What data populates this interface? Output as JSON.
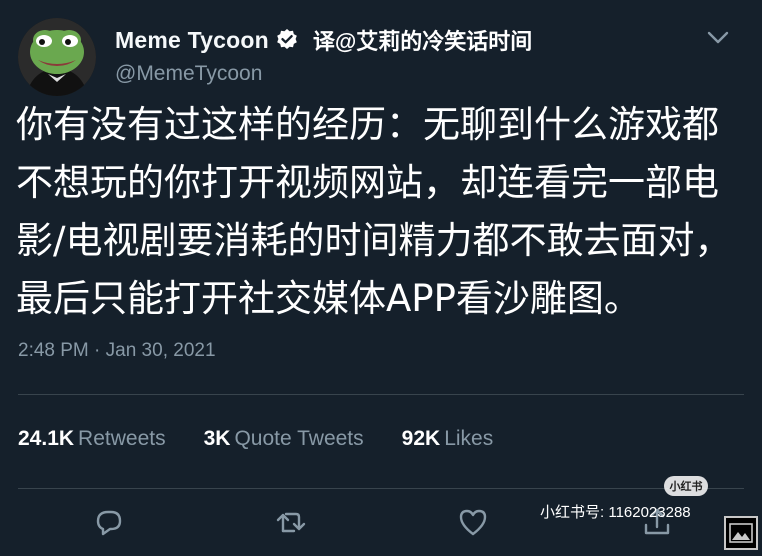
{
  "user": {
    "display_name": "Meme Tycoon",
    "handle": "@MemeTycoon",
    "verified": true
  },
  "overlay_credit": "译@艾莉的冷笑话时间",
  "tweet": {
    "lines": [
      "你有没有过这样的经历：无聊到什么游戏都",
      "不想玩的你打开视频网站，却连看完一部电",
      "影/电视剧要消耗的时间精力都不敢去面对，",
      "最后只能打开社交媒体APP看沙雕图。"
    ]
  },
  "meta": {
    "timestamp": "2:48 PM · Jan 30, 2021"
  },
  "stats": [
    {
      "count": "24.1K",
      "label": "Retweets"
    },
    {
      "count": "3K",
      "label": "Quote Tweets"
    },
    {
      "count": "92K",
      "label": "Likes"
    }
  ],
  "actions": [
    "reply",
    "retweet",
    "like",
    "share"
  ],
  "watermark": {
    "badge": "小红书",
    "id_text": "小红书号: 1162023288"
  },
  "colors": {
    "background": "#15202b",
    "secondary_text": "#8899a6",
    "verified_blue": "#1da1f2",
    "divider": "#38444d"
  }
}
